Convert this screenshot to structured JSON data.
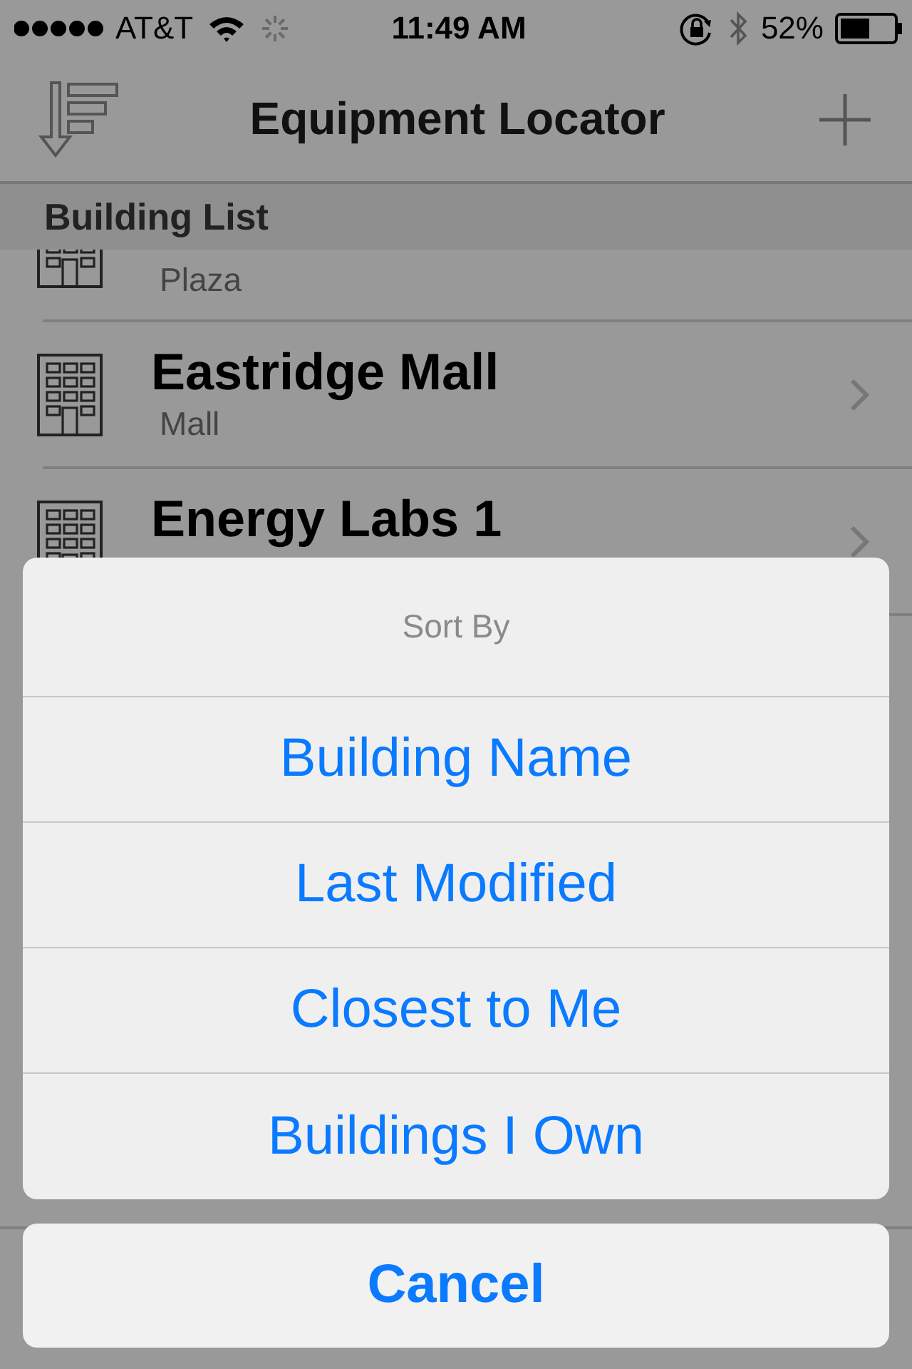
{
  "status_bar": {
    "carrier": "AT&T",
    "time": "11:49 AM",
    "battery": "52%"
  },
  "nav_bar": {
    "title": "Equipment Locator"
  },
  "section_header": "Building List",
  "rows": [
    {
      "subtitle": "Plaza"
    },
    {
      "title": "Eastridge Mall",
      "subtitle": "Mall"
    },
    {
      "title": "Energy Labs 1"
    }
  ],
  "action_sheet": {
    "title": "Sort By",
    "options": [
      "Building Name",
      "Last Modified",
      "Closest to Me",
      "Buildings I Own"
    ],
    "cancel": "Cancel"
  }
}
